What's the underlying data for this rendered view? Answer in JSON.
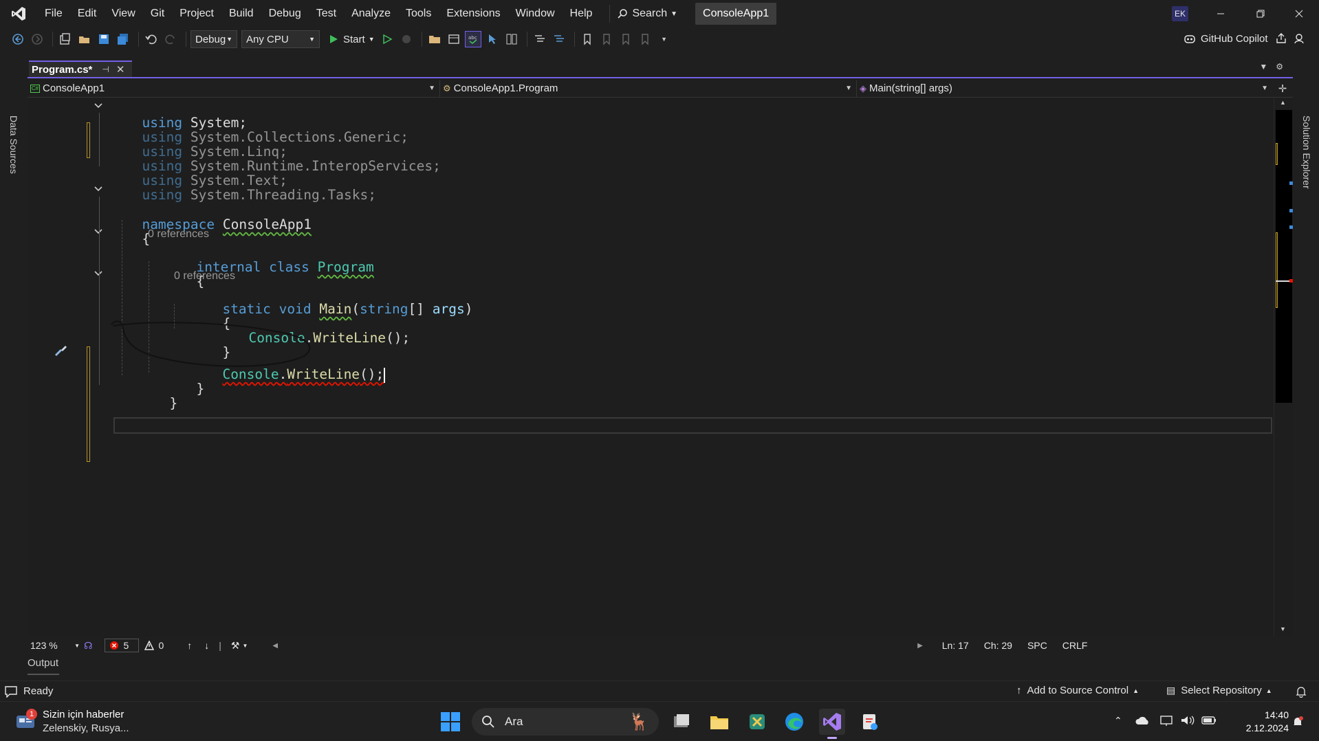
{
  "menu": [
    "File",
    "Edit",
    "View",
    "Git",
    "Project",
    "Build",
    "Debug",
    "Test",
    "Analyze",
    "Tools",
    "Extensions",
    "Window",
    "Help"
  ],
  "search_label": "Search",
  "solution_name": "ConsoleApp1",
  "account_initials": "EK",
  "toolbar": {
    "config": "Debug",
    "platform": "Any CPU",
    "start_label": "Start",
    "copilot_label": "GitHub Copilot"
  },
  "side": {
    "left": "Data Sources",
    "right": "Solution Explorer"
  },
  "tab": {
    "title": "Program.cs*"
  },
  "navbar": {
    "project": "ConsoleApp1",
    "type": "ConsoleApp1.Program",
    "member": "Main(string[] args)"
  },
  "code": {
    "using1": [
      "using",
      "System",
      ";"
    ],
    "using2": [
      "using",
      "System",
      ".",
      "Collections",
      ".",
      "Generic",
      ";"
    ],
    "using3": [
      "using",
      "System",
      ".",
      "Linq",
      ";"
    ],
    "using4": [
      "using",
      "System",
      ".",
      "Runtime",
      ".",
      "InteropServices",
      ";"
    ],
    "using5": [
      "using",
      "System",
      ".",
      "Text",
      ";"
    ],
    "using6": [
      "using",
      "System",
      ".",
      "Threading",
      ".",
      "Tasks",
      ";"
    ],
    "ns_kw": "namespace",
    "ns_name": "ConsoleApp1",
    "open_brace": "{",
    "close_brace": "}",
    "refs": "0 references",
    "class_mods": "internal class",
    "class_name": "Program",
    "method_mods": "static void",
    "method_name": "Main",
    "param_type": "string",
    "param_suffix": "[]",
    "param_name": "args",
    "paren_open": "(",
    "paren_close": ")",
    "console": "Console",
    "writeline": "WriteLine",
    "call_tail": "();",
    "dot": "."
  },
  "editor_status": {
    "zoom": "123 %",
    "errors": "5",
    "warnings": "0",
    "line": "Ln: 17",
    "col": "Ch: 29",
    "spacing": "SPC",
    "eol": "CRLF"
  },
  "output_label": "Output",
  "status": {
    "ready": "Ready",
    "source_control": "Add to Source Control",
    "repository": "Select Repository"
  },
  "taskbar": {
    "news_badge": "1",
    "news_title": "Sizin için haberler",
    "news_sub": "Zelenskiy, Rusya...",
    "search": "Ara",
    "time": "14:40",
    "date": "2.12.2024"
  },
  "colors": {
    "accent": "#7160e8",
    "keyword": "#569cd6",
    "type": "#4ec9b0",
    "method": "#dcdcaa",
    "error": "#e51400"
  }
}
